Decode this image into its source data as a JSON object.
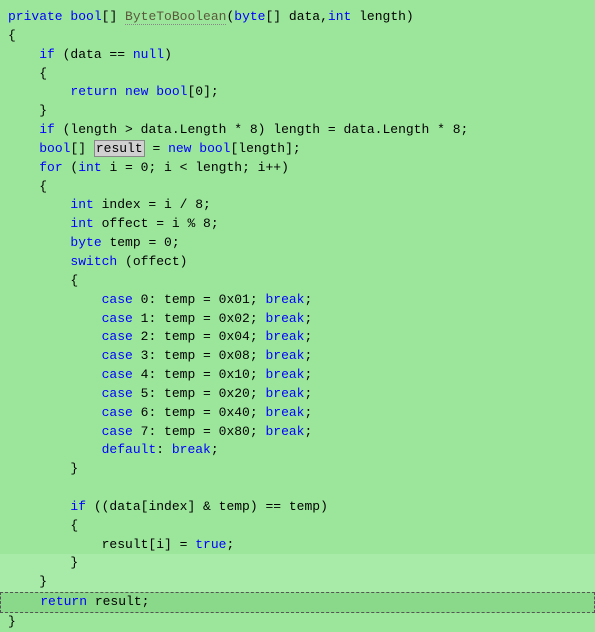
{
  "code": {
    "l1_private": "private",
    "l1_bool": "bool",
    "l1_method": "ByteToBoolean",
    "l1_byte": "byte",
    "l1_data": "[] data,",
    "l1_int": "int",
    "l1_length": " length)",
    "l2": "{",
    "l3_if": "if",
    "l3_rest": " (data == ",
    "l3_null": "null",
    "l3_close": ")",
    "l4": "    {",
    "l5_return": "return",
    "l5_new": "new",
    "l5_bool": "bool",
    "l5_rest": "[0];",
    "l6": "    }",
    "l7_if": "if",
    "l7_rest": " (length > data.Length * 8) length = data.Length * 8;",
    "l8_bool": "bool",
    "l8_open": "[] ",
    "l8_result": "result",
    "l8_eq": " = ",
    "l8_new": "new",
    "l8_bool2": "bool",
    "l8_rest": "[length];",
    "l9_for": "for",
    "l9_open": " (",
    "l9_int": "int",
    "l9_rest": " i = 0; i < length; i++)",
    "l10": "    {",
    "l11_int": "int",
    "l11_rest": " index = i / 8;",
    "l12_int": "int",
    "l12_rest": " offect = i % 8;",
    "l13_byte": "byte",
    "l13_rest": " temp = 0;",
    "l14_switch": "switch",
    "l14_rest": " (offect)",
    "l15": "        {",
    "l16_case": "case",
    "l16_rest": " 0: temp = 0x01; ",
    "l16_break": "break",
    "l17_case": "case",
    "l17_rest": " 1: temp = 0x02; ",
    "l17_break": "break",
    "l18_case": "case",
    "l18_rest": " 2: temp = 0x04; ",
    "l18_break": "break",
    "l19_case": "case",
    "l19_rest": " 3: temp = 0x08; ",
    "l19_break": "break",
    "l20_case": "case",
    "l20_rest": " 4: temp = 0x10; ",
    "l20_break": "break",
    "l21_case": "case",
    "l21_rest": " 5: temp = 0x20; ",
    "l21_break": "break",
    "l22_case": "case",
    "l22_rest": " 6: temp = 0x40; ",
    "l22_break": "break",
    "l23_case": "case",
    "l23_rest": " 7: temp = 0x80; ",
    "l23_break": "break",
    "l24_default": "default",
    "l24_rest": ": ",
    "l24_break": "break",
    "l25": "        }",
    "l26": "",
    "l27_if": "if",
    "l27_rest": " ((data[index] & temp) == temp)",
    "l28": "        {",
    "l29_pre": "            result[i] = ",
    "l29_true": "true",
    "l29_post": ";",
    "l30": "        }",
    "l31": "    }",
    "l32_return": "return",
    "l32_rest": " result;",
    "l33": "}",
    "semicolon": ";"
  }
}
